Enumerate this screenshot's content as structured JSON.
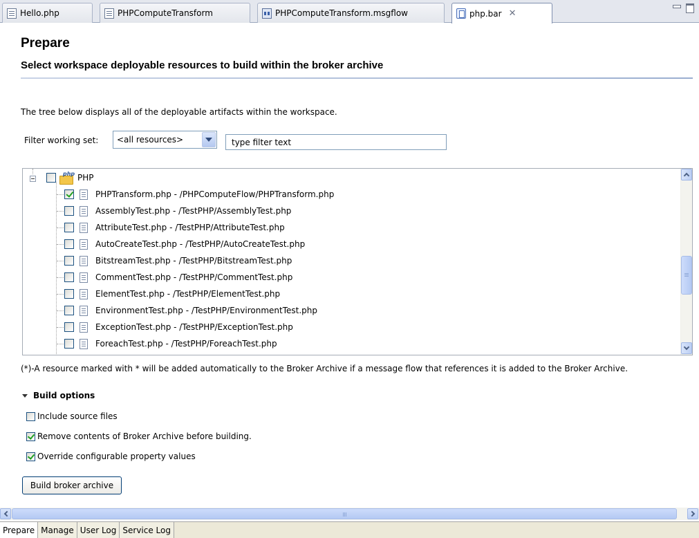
{
  "tabs": [
    {
      "label": "Hello.php",
      "icon": "php-file-icon"
    },
    {
      "label": "PHPComputeTransform",
      "icon": "php-file-icon"
    },
    {
      "label": "PHPComputeTransform.msgflow",
      "icon": "message-flow-icon"
    },
    {
      "label": "php.bar",
      "icon": "broker-archive-icon",
      "active": true
    }
  ],
  "page": {
    "title": "Prepare",
    "subtitle": "Select workspace deployable resources to build within the broker archive",
    "description": "The tree below displays all of the deployable artifacts within the workspace."
  },
  "filter": {
    "label": "Filter working set:",
    "selected": "<all resources>",
    "text": "type filter text"
  },
  "tree": {
    "root": {
      "label": "PHP",
      "checked": false
    },
    "items": [
      {
        "label": "PHPTransform.php - /PHPComputeFlow/PHPTransform.php",
        "checked": true
      },
      {
        "label": "AssemblyTest.php - /TestPHP/AssemblyTest.php",
        "checked": false
      },
      {
        "label": "AttributeTest.php - /TestPHP/AttributeTest.php",
        "checked": false
      },
      {
        "label": "AutoCreateTest.php - /TestPHP/AutoCreateTest.php",
        "checked": false
      },
      {
        "label": "BitstreamTest.php - /TestPHP/BitstreamTest.php",
        "checked": false
      },
      {
        "label": "CommentTest.php - /TestPHP/CommentTest.php",
        "checked": false
      },
      {
        "label": "ElementTest.php - /TestPHP/ElementTest.php",
        "checked": false
      },
      {
        "label": "EnvironmentTest.php - /TestPHP/EnvironmentTest.php",
        "checked": false
      },
      {
        "label": "ExceptionTest.php - /TestPHP/ExceptionTest.php",
        "checked": false
      },
      {
        "label": "ForeachTest.php - /TestPHP/ForeachTest.php",
        "checked": false
      }
    ]
  },
  "note": "(*)-A resource marked with * will be added automatically to the Broker Archive if a message flow that references it is added to the Broker Archive.",
  "build_options": {
    "header": "Build options",
    "options": [
      {
        "label": "Include source files",
        "checked": false
      },
      {
        "label": "Remove contents of Broker Archive before building.",
        "checked": true
      },
      {
        "label": "Override configurable property values",
        "checked": true
      }
    ],
    "build_button": "Build broker archive"
  },
  "bottom_tabs": [
    {
      "label": "Prepare",
      "active": true
    },
    {
      "label": "Manage"
    },
    {
      "label": "User Log"
    },
    {
      "label": "Service Log"
    }
  ]
}
